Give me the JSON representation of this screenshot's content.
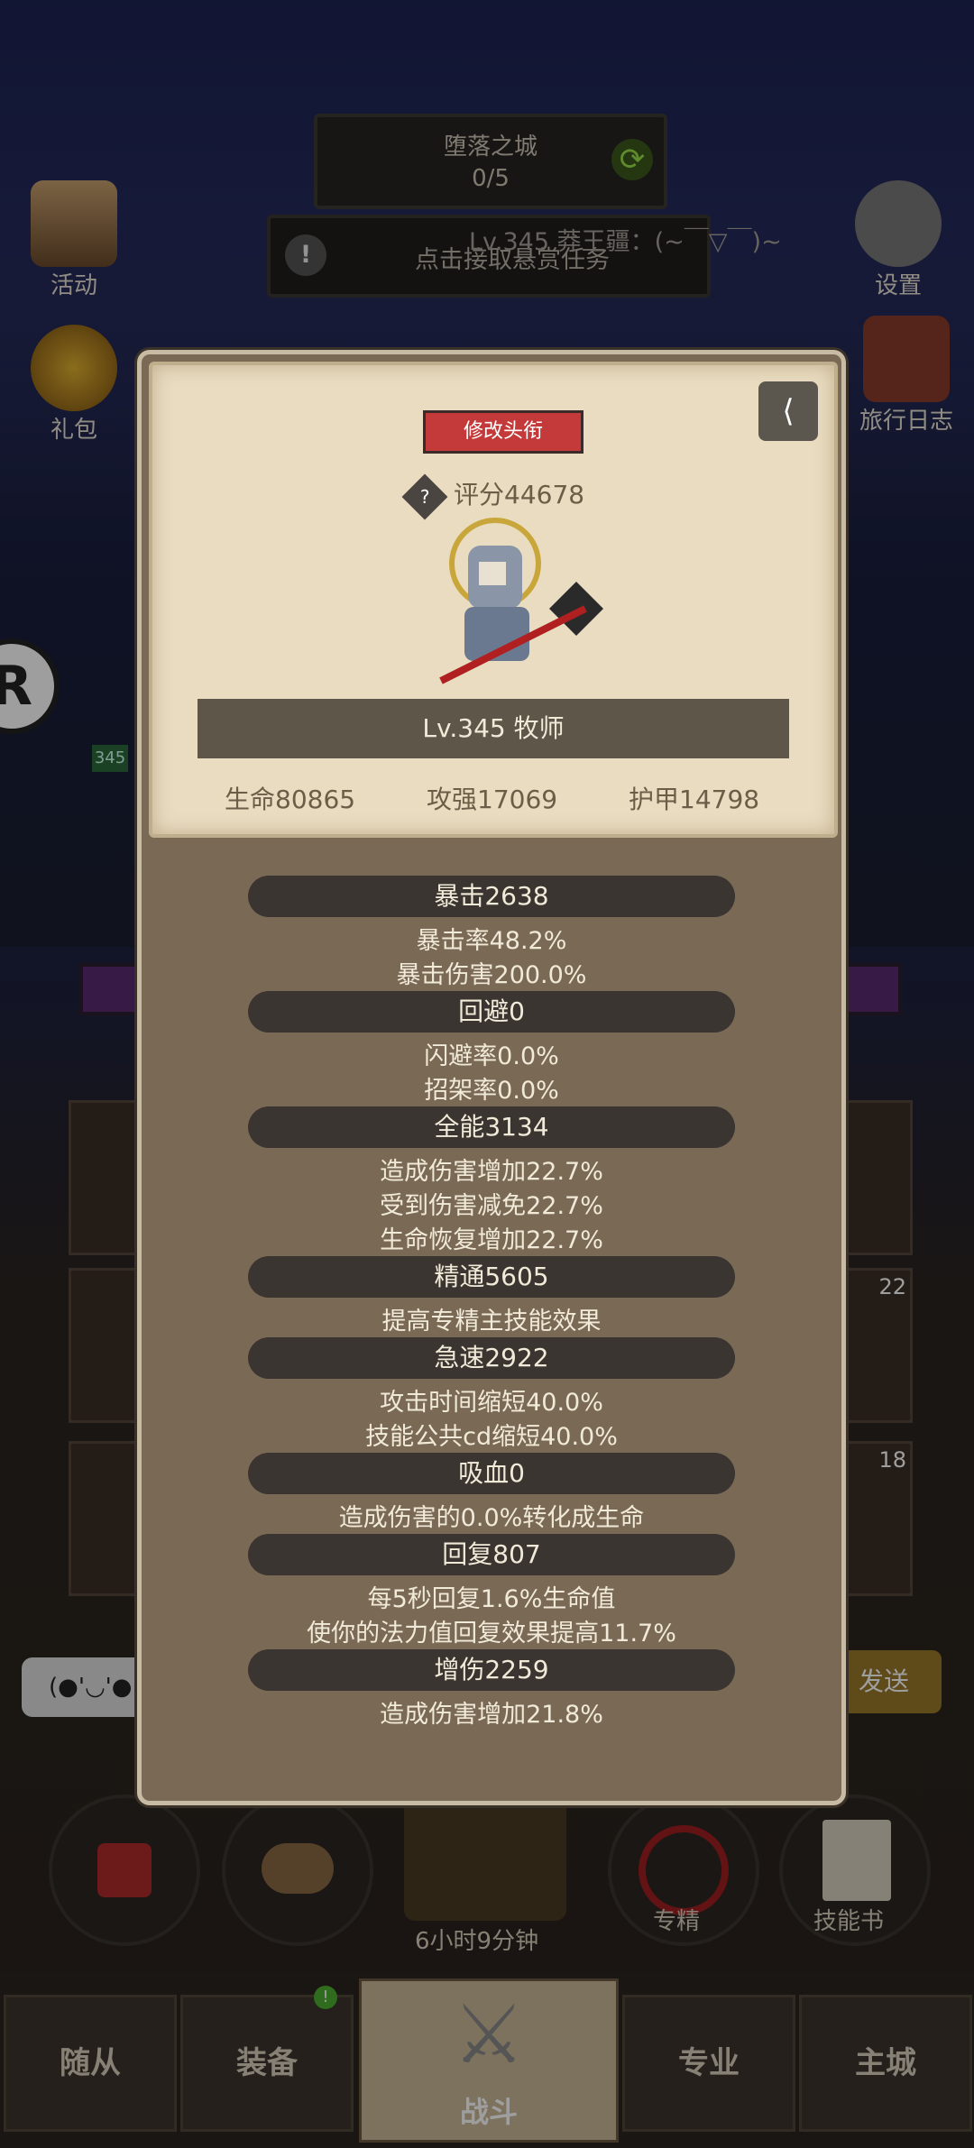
{
  "top": {
    "zone_title": "堕落之城",
    "zone_progress": "0/5",
    "quest_text": "点击接取悬赏任务",
    "player_overlay": "Lv.345 莽王疆：(~￣▽￣)~"
  },
  "side": {
    "activity": "活动",
    "settings": "设置",
    "gift": "礼包",
    "journal": "旅行日志",
    "small_level": "345"
  },
  "card": {
    "edit_title": "修改头衔",
    "score": "评分44678",
    "level_class": "Lv.345 牧师",
    "hp": "生命80865",
    "attack": "攻强17069",
    "armor": "护甲14798"
  },
  "stats": [
    {
      "head": "暴击2638",
      "lines": [
        "暴击率48.2%",
        "暴击伤害200.0%"
      ]
    },
    {
      "head": "回避0",
      "lines": [
        "闪避率0.0%",
        "招架率0.0%"
      ]
    },
    {
      "head": "全能3134",
      "lines": [
        "造成伤害增加22.7%",
        "受到伤害减免22.7%",
        "生命恢复增加22.7%"
      ]
    },
    {
      "head": "精通5605",
      "lines": [
        "提高专精主技能效果"
      ]
    },
    {
      "head": "急速2922",
      "lines": [
        "攻击时间缩短40.0%",
        "技能公共cd缩短40.0%"
      ]
    },
    {
      "head": "吸血0",
      "lines": [
        "造成伤害的0.0%转化成生命"
      ]
    },
    {
      "head": "回复807",
      "lines": [
        "每5秒回复1.6%生命值",
        "使你的法力值回复效果提高11.7%"
      ]
    },
    {
      "head": "增伤2259",
      "lines": [
        "造成伤害增加21.8%"
      ]
    }
  ],
  "bottom": {
    "timer": "6小时9分钟",
    "specialty": "专精",
    "skillbook": "技能书",
    "tab_followers": "随从",
    "tab_equip": "装备",
    "tab_fight": "战斗",
    "tab_prof": "专业",
    "tab_city": "主城",
    "equip_badge": "!",
    "chat_emote": "(●'◡'●",
    "send": "发送"
  },
  "slots": {
    "badge22": "22",
    "badge18": "18"
  }
}
